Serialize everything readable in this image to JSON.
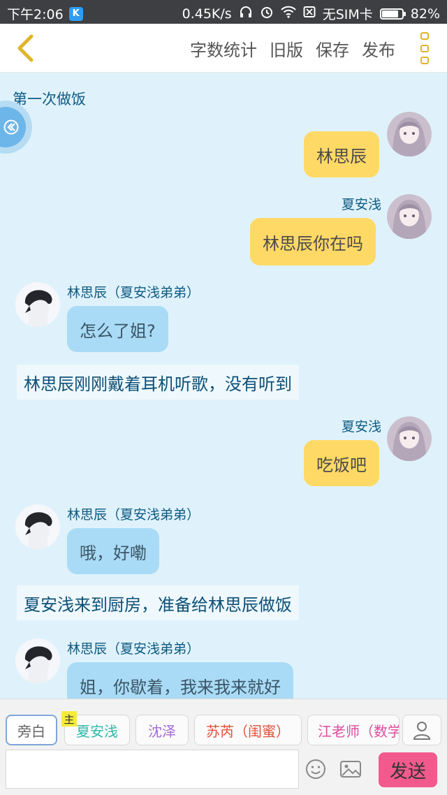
{
  "status_bar": {
    "time": "下午2:06",
    "app_badge": "K",
    "speed": "0.45K/s",
    "sim": "无SIM卡",
    "battery_pct": "82%",
    "battery_level": 0.82,
    "icons": [
      "headphones-icon",
      "alarm-icon",
      "wifi-icon",
      "sim-icon",
      "battery-icon"
    ]
  },
  "toolbar": {
    "back_icon": "chevron-left-icon",
    "word_count": "字数统计",
    "old_version": "旧版",
    "save": "保存",
    "publish": "发布",
    "more_icon": "more-vertical-icon",
    "accent": "#e0b52a"
  },
  "chat": {
    "title": "第一次做饭",
    "messages": [
      {
        "type": "bubble",
        "side": "right",
        "speaker": "",
        "text": "林思辰"
      },
      {
        "type": "bubble",
        "side": "right",
        "speaker": "夏安浅",
        "text": "林思辰你在吗"
      },
      {
        "type": "bubble",
        "side": "left",
        "speaker": "林思辰（夏安浅弟弟）",
        "text": "怎么了姐?"
      },
      {
        "type": "narration",
        "text": "林思辰刚刚戴着耳机听歌，没有听到"
      },
      {
        "type": "bubble",
        "side": "right",
        "speaker": "夏安浅",
        "text": "吃饭吧"
      },
      {
        "type": "bubble",
        "side": "left",
        "speaker": "林思辰（夏安浅弟弟）",
        "text": "哦，好嘞"
      },
      {
        "type": "narration",
        "text": "夏安浅来到厨房，准备给林思辰做饭"
      },
      {
        "type": "bubble",
        "side": "left",
        "speaker": "林思辰（夏安浅弟弟）",
        "text": "姐，你歇着，我来我来就好"
      }
    ]
  },
  "roles": {
    "items": [
      {
        "label": "旁白",
        "color": "#666666"
      },
      {
        "label": "夏安浅",
        "color": "#2fb8a8"
      },
      {
        "label": "沈泽",
        "color": "#a46bd6"
      },
      {
        "label": "苏芮（闺蜜）",
        "color": "#e0513a"
      },
      {
        "label": "江老师（数学",
        "color": "#e04a9e"
      }
    ],
    "host_tag": "主",
    "person_icon": "person-icon"
  },
  "composer": {
    "placeholder": "",
    "value": "",
    "emoji_icon": "smiley-icon",
    "image_icon": "image-icon",
    "send": "发送"
  }
}
